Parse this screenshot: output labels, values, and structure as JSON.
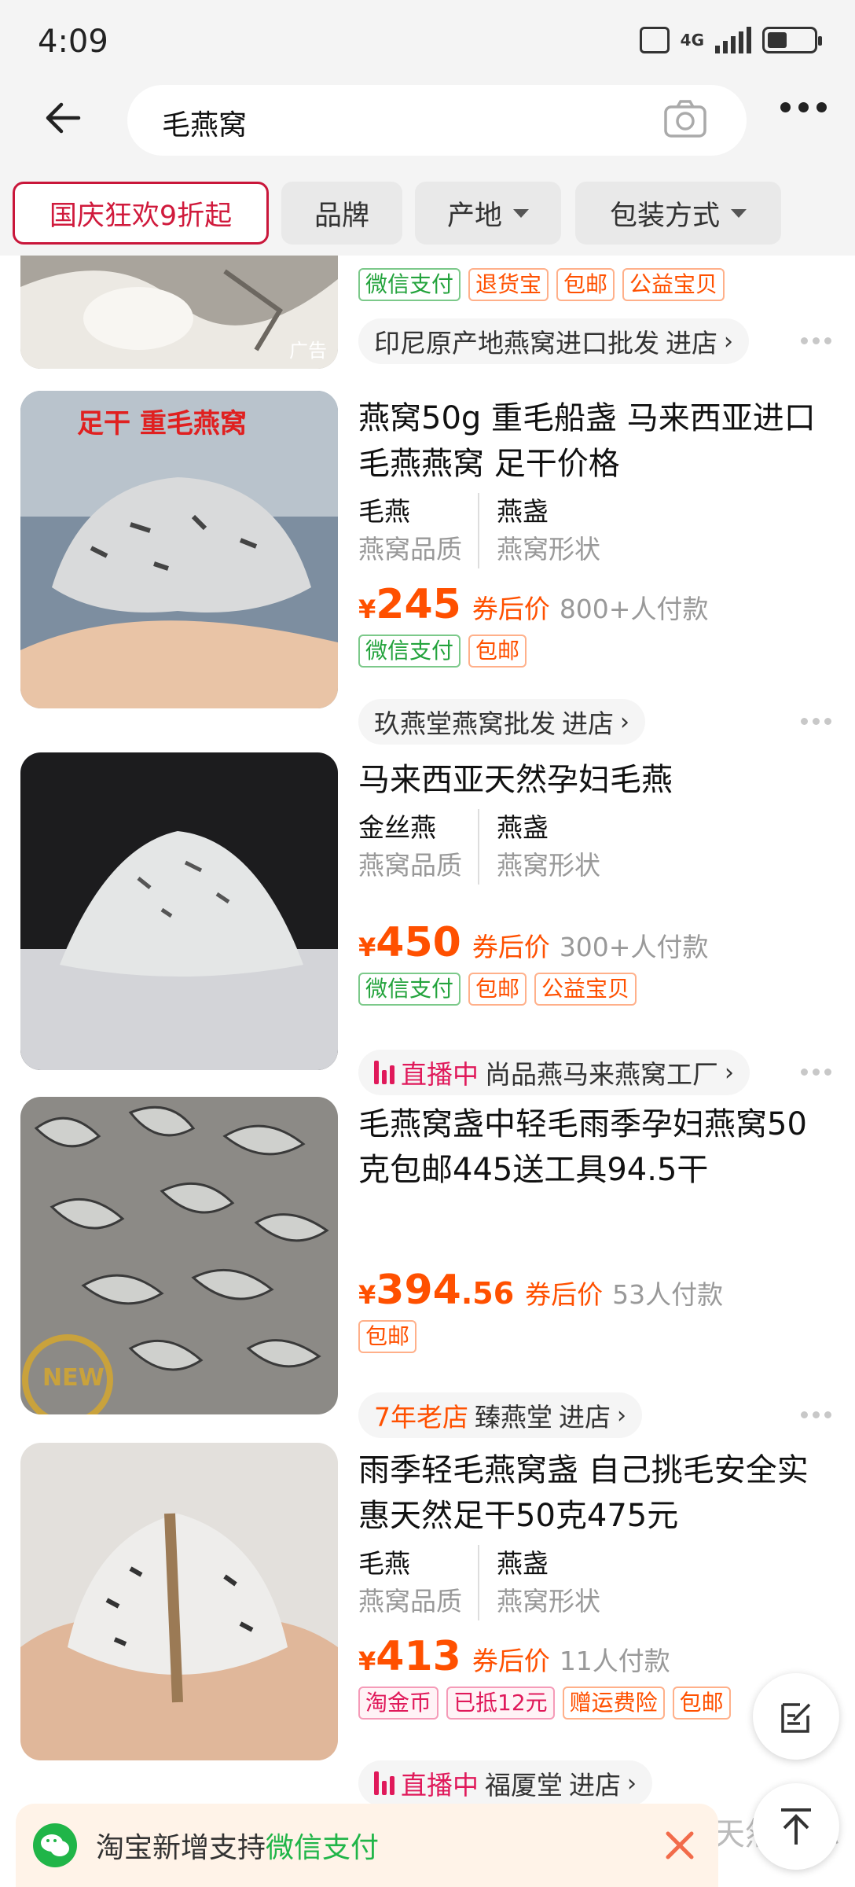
{
  "status_bar": {
    "time": "4:09",
    "network": "4G"
  },
  "search": {
    "query": "毛燕窝"
  },
  "filters": [
    {
      "label": "国庆狂欢9折起"
    },
    {
      "label": "品牌"
    },
    {
      "label": "产地"
    },
    {
      "label": "包装方式"
    }
  ],
  "products": [
    {
      "ad_label": "广告",
      "tags": [
        "微信支付",
        "退货宝",
        "包邮",
        "公益宝贝"
      ],
      "shop": "印尼原产地燕窝进口批发",
      "shop_action": "进店"
    },
    {
      "image_caption": "足干 重毛燕窝",
      "title": "燕窝50g 重毛船盏 马来西亚进口毛燕燕窝 足干价格",
      "attrs": [
        {
          "value": "毛燕",
          "key": "燕窝品质"
        },
        {
          "value": "燕盏",
          "key": "燕窝形状"
        }
      ],
      "currency": "¥",
      "price": "245",
      "price_note": "券后价",
      "paid_count": "800+人付款",
      "tags": [
        "微信支付",
        "包邮"
      ],
      "shop": "玖燕堂燕窝批发",
      "shop_action": "进店"
    },
    {
      "title": "马来西亚天然孕妇毛燕",
      "attrs": [
        {
          "value": "金丝燕",
          "key": "燕窝品质"
        },
        {
          "value": "燕盏",
          "key": "燕窝形状"
        }
      ],
      "currency": "¥",
      "price": "450",
      "price_note": "券后价",
      "paid_count": "300+人付款",
      "tags": [
        "微信支付",
        "包邮",
        "公益宝贝"
      ],
      "live_label": "直播中",
      "shop": "尚品燕马来燕窝工厂",
      "shop_action": ""
    },
    {
      "image_caption": "NEW",
      "title": "毛燕窝盏中轻毛雨季孕妇燕窝50克包邮445送工具94.5干",
      "currency": "¥",
      "price": "394",
      "price_decimal": ".56",
      "price_note": "券后价",
      "paid_count": "53人付款",
      "tags": [
        "包邮"
      ],
      "store_age": "7年老店",
      "shop": "臻燕堂",
      "shop_action": "进店"
    },
    {
      "title": "雨季轻毛燕窝盏 自己挑毛安全实惠天然足干50克475元",
      "attrs": [
        {
          "value": "毛燕",
          "key": "燕窝品质"
        },
        {
          "value": "燕盏",
          "key": "燕窝形状"
        }
      ],
      "currency": "¥",
      "price": "413",
      "price_note": "券后价",
      "paid_count": "11人付款",
      "tags": [
        "淘金币",
        "已抵12元",
        "赠运费险",
        "包邮"
      ],
      "live_label": "直播中",
      "shop": "福厦堂",
      "shop_action": "进店"
    }
  ],
  "toast": {
    "message": "淘宝新增支持",
    "highlight": "微信支付"
  },
  "peek_text": "天然零添"
}
